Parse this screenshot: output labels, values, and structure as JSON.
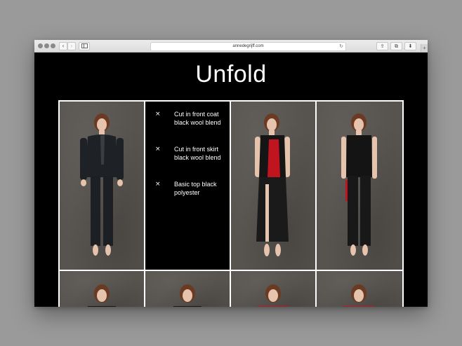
{
  "browser": {
    "url": "annedegrijff.com",
    "back_glyph": "‹",
    "forward_glyph": "›",
    "reload_glyph": "↻",
    "share_glyph": "⇪",
    "tabs_glyph": "⧉",
    "download_glyph": "⬇",
    "newtab_glyph": "+"
  },
  "page": {
    "title": "Unfold"
  },
  "garment_list": [
    {
      "bullet": "×",
      "text": "Cut in front coat black wool blend"
    },
    {
      "bullet": "×",
      "text": "Cut in front skirt black wool blend"
    },
    {
      "bullet": "×",
      "text": "Basic top black polyester"
    }
  ],
  "colors": {
    "page_bg": "#000000",
    "photo_bg": "#57534f",
    "accent_red": "#c0141f",
    "grid_border": "#ffffff"
  }
}
